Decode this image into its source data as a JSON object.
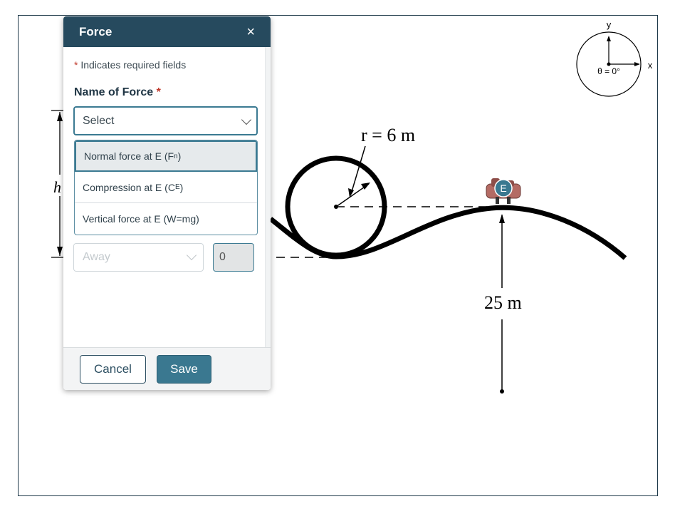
{
  "diagram": {
    "radius_label": "r = 6 m",
    "height_var": "h",
    "distance_label": "25 m",
    "point_label": "E"
  },
  "axes_widget": {
    "y_label": "y",
    "x_label": "x",
    "angle_readout": "θ = 0°"
  },
  "dialog": {
    "title": "Force",
    "close_glyph": "×",
    "required_note_star": "*",
    "required_note": "Indicates required fields",
    "name_label": "Name of Force",
    "name_required_star": "*",
    "select_value": "Select",
    "options": [
      {
        "text": "Normal force at E (F",
        "sub": "n",
        "after": ")"
      },
      {
        "text": "Compression at E (C",
        "sub": "E",
        "after": ")"
      },
      {
        "text": "Vertical force at E (W=mg)",
        "sub": "",
        "after": ""
      }
    ],
    "direction_placeholder": "Away",
    "angle_value": "0",
    "cancel_label": "Cancel",
    "save_label": "Save"
  }
}
